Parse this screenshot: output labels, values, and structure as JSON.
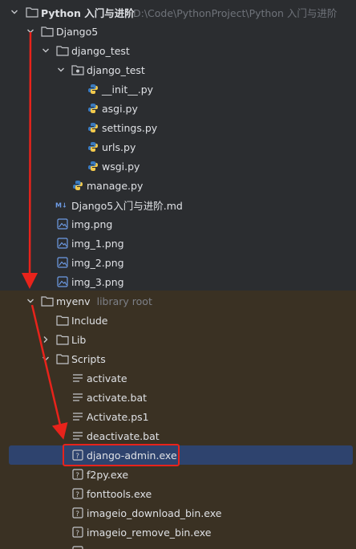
{
  "tree": {
    "project_root": {
      "label": "Python 入门与进阶",
      "path": "D:\\Code\\PythonProject\\Python 入门与进阶"
    },
    "django5": {
      "label": "Django5"
    },
    "django_test_folder": {
      "label": "django_test"
    },
    "django_test_pkg": {
      "label": "django_test"
    },
    "files_pkg": [
      {
        "label": "__init__.py"
      },
      {
        "label": "asgi.py"
      },
      {
        "label": "settings.py"
      },
      {
        "label": "urls.py"
      },
      {
        "label": "wsgi.py"
      }
    ],
    "manage": {
      "label": "manage.py"
    },
    "markdown": {
      "label": "Django5入门与进阶.md"
    },
    "images": [
      {
        "label": "img.png"
      },
      {
        "label": "img_1.png"
      },
      {
        "label": "img_2.png"
      },
      {
        "label": "img_3.png"
      }
    ],
    "myenv": {
      "label": "myenv",
      "hint": "library root"
    },
    "include": {
      "label": "Include"
    },
    "lib": {
      "label": "Lib"
    },
    "scripts": {
      "label": "Scripts"
    },
    "script_files": [
      {
        "label": "activate"
      },
      {
        "label": "activate.bat"
      },
      {
        "label": "Activate.ps1"
      },
      {
        "label": "deactivate.bat"
      }
    ],
    "exe_files": [
      {
        "label": "django-admin.exe"
      },
      {
        "label": "f2py.exe"
      },
      {
        "label": "fonttools.exe"
      },
      {
        "label": "imageio_download_bin.exe"
      },
      {
        "label": "imageio_remove_bin.exe"
      }
    ]
  },
  "colors": {
    "background": "#2b2d30",
    "library_bg": "#3a3123",
    "selection": "#2e436e",
    "annotation_red": "#e8231b",
    "folder_stroke": "#c4c6ca",
    "python_blue": "#3b7bbf",
    "python_yellow": "#f2c94c"
  }
}
